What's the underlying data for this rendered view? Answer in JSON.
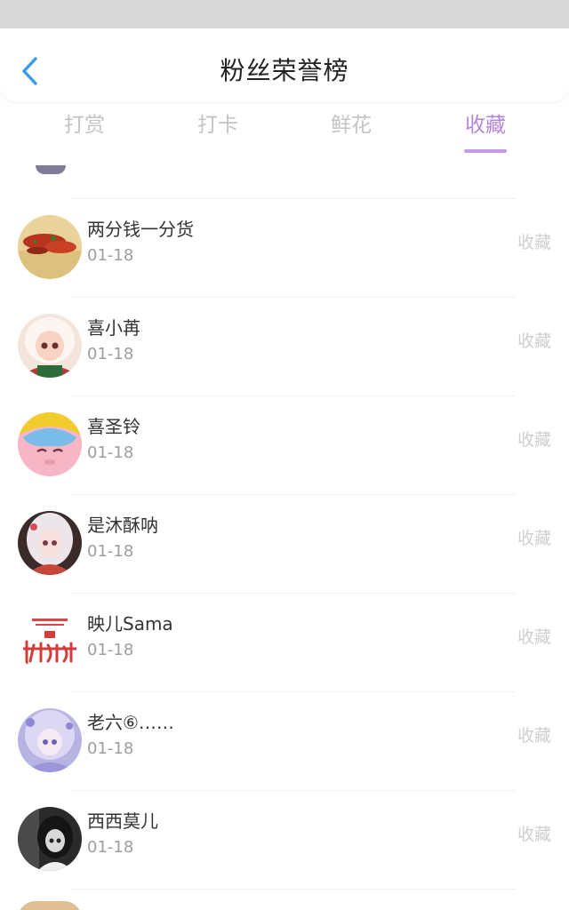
{
  "header": {
    "title": "粉丝荣誉榜",
    "back_icon": "chevron-left-icon",
    "accent_color": "#3a9bea"
  },
  "tabs": [
    {
      "label": "打赏",
      "active": false
    },
    {
      "label": "打卡",
      "active": false
    },
    {
      "label": "鲜花",
      "active": false
    },
    {
      "label": "收藏",
      "active": true
    }
  ],
  "active_tab_color": "#b287db",
  "fans": [
    {
      "name": "两分钱一分货",
      "date": "01-18",
      "action": "收藏"
    },
    {
      "name": "喜小苒",
      "date": "01-18",
      "action": "收藏"
    },
    {
      "name": "喜圣铃",
      "date": "01-18",
      "action": "收藏"
    },
    {
      "name": "是沐酥呐",
      "date": "01-18",
      "action": "收藏"
    },
    {
      "name": "映儿Sama",
      "date": "01-18",
      "action": "收藏"
    },
    {
      "name": "老六⑥……",
      "date": "01-18",
      "action": "收藏"
    },
    {
      "name": "西西莫儿",
      "date": "01-18",
      "action": "收藏"
    }
  ]
}
